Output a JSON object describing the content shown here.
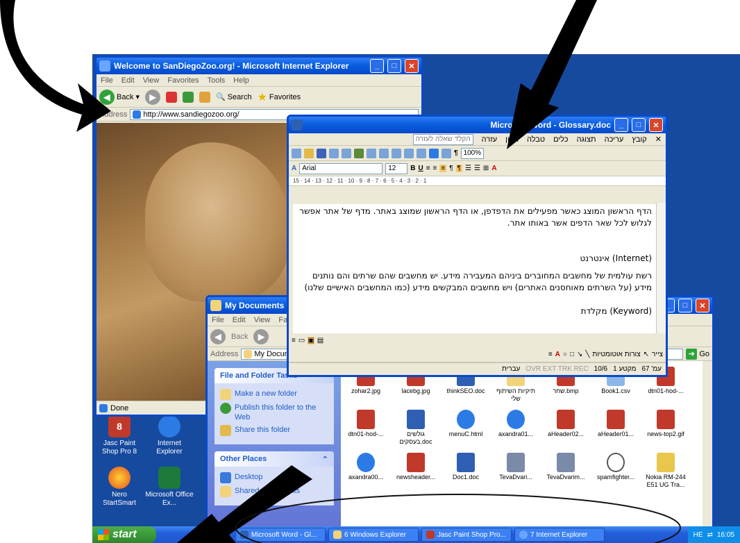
{
  "ie": {
    "title": "Welcome to SanDiegoZoo.org! - Microsoft Internet Explorer",
    "menu": [
      "File",
      "Edit",
      "View",
      "Favorites",
      "Tools",
      "Help"
    ],
    "back": "Back",
    "search": "Search",
    "favorites": "Favorites",
    "address_label": "Address",
    "url": "http://www.sandiegozoo.org/",
    "status": "Done"
  },
  "word": {
    "title": "Microsoft Word - Glossary.doc",
    "menu": [
      "קובץ",
      "עריכה",
      "תצוגה",
      "כלים",
      "טבלה",
      "חלון",
      "עזרה"
    ],
    "help_box": "הקלד שאלה לעזרה",
    "zoom": "100%",
    "font": "Arial",
    "size": "12",
    "ruler": "15 · 14 · 13 · 12 · 11 · 10 · 9 · 8 · 7 · 6 · 5 · 4 · 3 · 2 · 1",
    "paragraphs": [
      "הדף הראשון המוצג כאשר מפעילים את הדפדפן, או הדף הראשון שמוצג באתר. מדף של אתר אפשר לגלוש לכל שאר הדפים אשר באותו אתר.",
      "(Internet) אינטרנט",
      "רשת עולמית של מחשבים המחוברים ביניהם המעבירה מידע. יש מחשבים שהם שרתים והם נותנים מידע (על השרתים מאוחסנים האתרים) ויש מחשבים המבקשים מידע (כמו המחשבים האישיים שלנו)",
      "(Keyword) מקלדת"
    ],
    "drawing": "צורות אוטומטיות",
    "draw_label": "צייר",
    "status": {
      "lang": "עברית",
      "flags": "OVR EXT TRK REC",
      "pos": "10/6",
      "section": "מקטע 1",
      "page": "עמ' 67"
    }
  },
  "mydocs": {
    "title": "My Documents",
    "menu": [
      "File",
      "Edit",
      "View",
      "Fa"
    ],
    "back": "Back",
    "address_label": "Address",
    "address": "My Docume",
    "go": "Go",
    "tasks_header": "File and Folder Tasks",
    "tasks": [
      "Make a new folder",
      "Publish this folder to the Web",
      "Share this folder"
    ],
    "places_header": "Other Places",
    "places": [
      "Desktop",
      "Shared Documents"
    ],
    "files": [
      "zohar2.jpg",
      "lacebg.jpg",
      "thinkSEO.doc",
      "תיקיות השיתוף שלי",
      "שחר.bmp",
      "Book1.csv",
      "dtn01-hod-...",
      "dtn01-hod-...",
      "גולשים בעסקים.doc",
      "menuC.html",
      "axandra01...",
      "aHeader02...",
      "aHeader01...",
      "news-top2.gif",
      "axandra00...",
      "newsheader...",
      "Doc1.doc",
      "TevaDvari...",
      "TevaDvarim...",
      "spamfighter...",
      "Nokia RM-244 E51 UG Tra..."
    ]
  },
  "desktop": {
    "icons": [
      "Jasc Paint Shop Pro 8",
      "Internet Explorer",
      "Nero StartSmart",
      "Microsoft Office Ex..."
    ]
  },
  "taskbar": {
    "start": "start",
    "tasks": [
      "Microsoft Word - Gl...",
      "6 Windows Explorer",
      "Jasc Paint Shop Pro...",
      "7 Internet Explorer"
    ],
    "lang": "HE",
    "time": "16:05"
  }
}
